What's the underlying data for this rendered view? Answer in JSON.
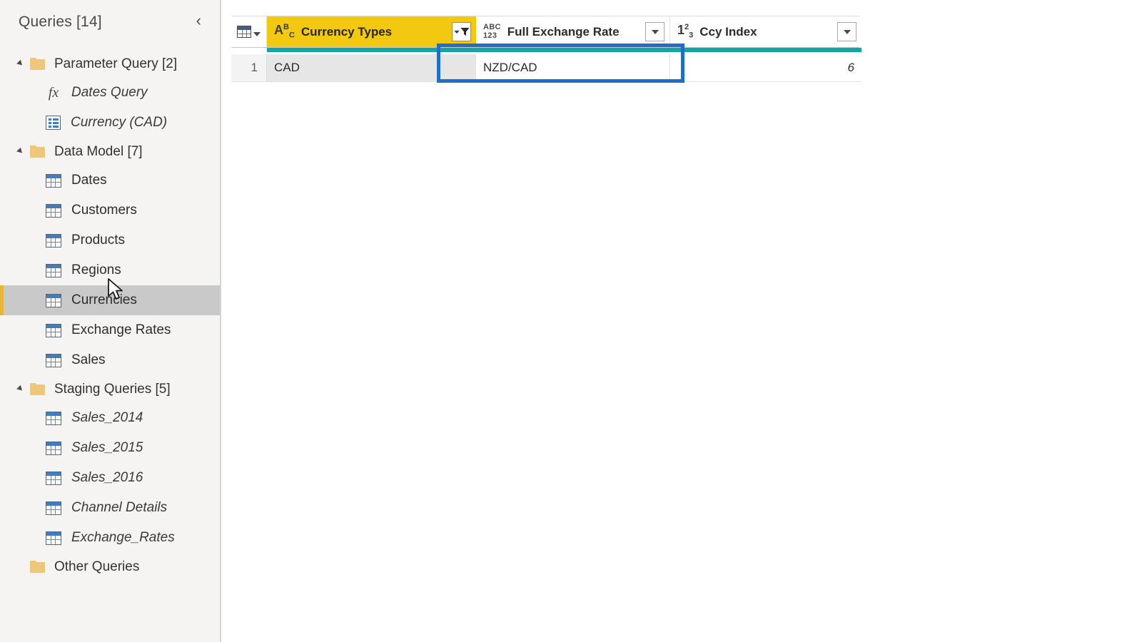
{
  "sidebar": {
    "title": "Queries [14]",
    "collapse_icon": "chevron-left-icon",
    "groups": [
      {
        "label": "Parameter Query [2]",
        "expanded": true,
        "items": [
          {
            "label": "Dates Query",
            "icon": "fx-function-icon",
            "italic": true,
            "selected": false
          },
          {
            "label": "Currency (CAD)",
            "icon": "parameter-list-icon",
            "italic": true,
            "selected": false
          }
        ]
      },
      {
        "label": "Data Model [7]",
        "expanded": true,
        "items": [
          {
            "label": "Dates",
            "icon": "table-icon",
            "italic": false,
            "selected": false
          },
          {
            "label": "Customers",
            "icon": "table-icon",
            "italic": false,
            "selected": false
          },
          {
            "label": "Products",
            "icon": "table-icon",
            "italic": false,
            "selected": false
          },
          {
            "label": "Regions",
            "icon": "table-icon",
            "italic": false,
            "selected": false
          },
          {
            "label": "Currencies",
            "icon": "table-icon",
            "italic": false,
            "selected": true
          },
          {
            "label": "Exchange Rates",
            "icon": "table-icon",
            "italic": false,
            "selected": false
          },
          {
            "label": "Sales",
            "icon": "table-icon",
            "italic": false,
            "selected": false
          }
        ]
      },
      {
        "label": "Staging Queries [5]",
        "expanded": true,
        "items": [
          {
            "label": "Sales_2014",
            "icon": "table-icon",
            "italic": true,
            "selected": false
          },
          {
            "label": "Sales_2015",
            "icon": "table-icon",
            "italic": true,
            "selected": false
          },
          {
            "label": "Sales_2016",
            "icon": "table-icon",
            "italic": true,
            "selected": false
          },
          {
            "label": "Channel Details",
            "icon": "table-icon",
            "italic": true,
            "selected": false
          },
          {
            "label": "Exchange_Rates",
            "icon": "table-icon",
            "italic": true,
            "selected": false
          }
        ]
      },
      {
        "label": "Other Queries",
        "expanded": false,
        "items": []
      }
    ]
  },
  "grid": {
    "corner_icon": "table-select-all-icon",
    "columns": [
      {
        "name": "Currency Types",
        "type_icon": "text-type-icon",
        "type_glyph": "ABC",
        "highlighted": true,
        "filtered": true,
        "button_icon": "filter-funnel-icon"
      },
      {
        "name": "Full Exchange Rate",
        "type_icon": "any-type-icon",
        "type_glyph": "ABC123",
        "highlighted": false,
        "filtered": false,
        "button_icon": "chevron-down-icon"
      },
      {
        "name": "Ccy Index",
        "type_icon": "whole-number-type-icon",
        "type_glyph": "123",
        "highlighted": false,
        "filtered": false,
        "button_icon": "chevron-down-icon"
      }
    ],
    "rows": [
      {
        "number": "1",
        "cells": [
          "CAD",
          "NZD/CAD",
          "6"
        ]
      }
    ],
    "quality_bar_color": "#12a5a5"
  },
  "annotation": {
    "type": "highlight-rectangle",
    "color": "#1f6fc4"
  },
  "colors": {
    "header_highlight": "#f2c811",
    "selection_accent": "#e8b33c",
    "selected_row_bg": "#c9c9c9",
    "quality_teal": "#12a5a5",
    "annotation_blue": "#1f6fc4"
  }
}
